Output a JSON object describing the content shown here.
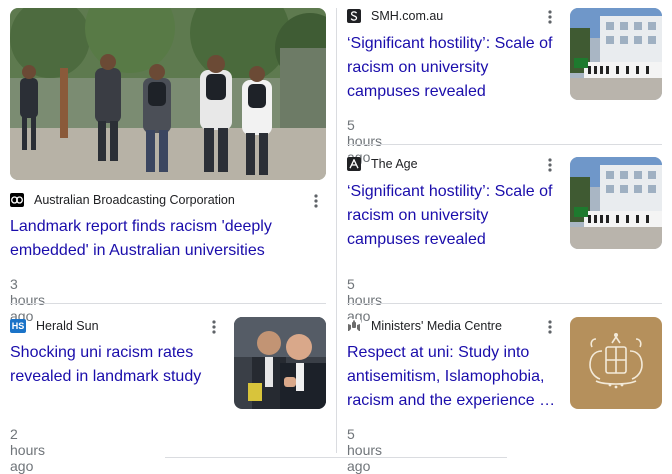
{
  "cards": [
    {
      "source": "Australian Broadcasting Corporation",
      "source_icon": "abc-logo-icon",
      "title": "Landmark report finds racism 'deeply embedded' in Australian universities",
      "time": "3 hours ago"
    },
    {
      "source": "SMH.com.au",
      "source_icon": "smh-logo-icon",
      "title": "‘Significant hostility’: Scale of racism on university campuses revealed",
      "time": "5 hours ago"
    },
    {
      "source": "The Age",
      "source_icon": "the-age-logo-icon",
      "title": "‘Significant hostility’: Scale of racism on university campuses revealed",
      "time": "5 hours ago"
    },
    {
      "source": "Herald Sun",
      "source_icon": "herald-sun-logo-icon",
      "logo_text": "HS",
      "title": "Shocking uni racism rates revealed in landmark study",
      "time": "2 hours ago"
    },
    {
      "source": "Ministers' Media Centre",
      "source_icon": "coat-of-arms-icon",
      "title": "Respect at uni: Study into antisemitism, Islamophobia, racism and the experience of First Nations people",
      "time": "5 hours ago"
    }
  ],
  "colors": {
    "title_link": "#1a0dab",
    "meta_text": "#70757a",
    "divider": "#dadce0",
    "herald_sun_blue": "#1a73c8"
  }
}
